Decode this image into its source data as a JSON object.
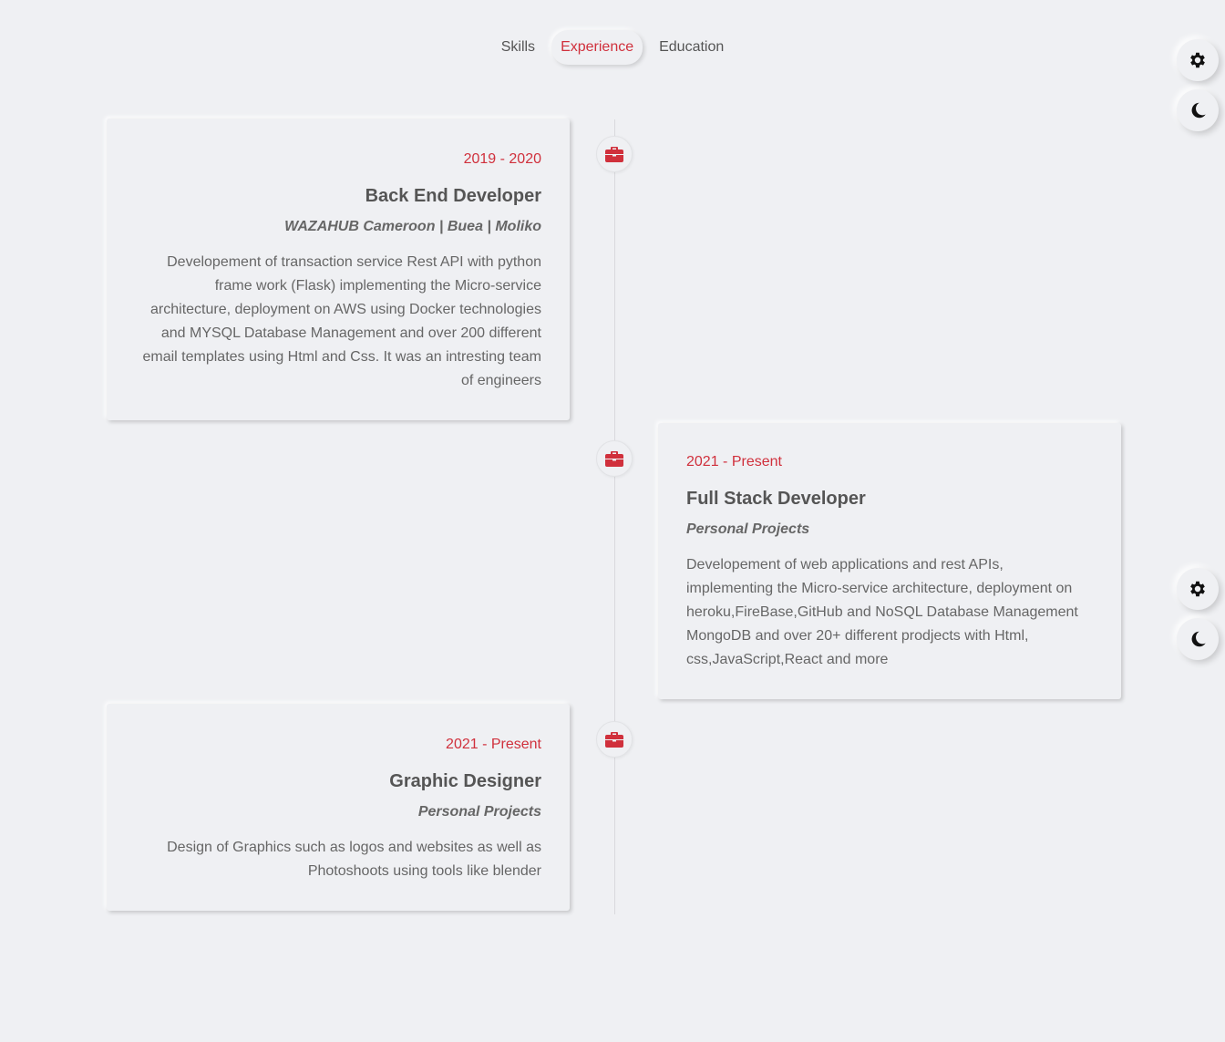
{
  "tabs": [
    {
      "label": "Skills"
    },
    {
      "label": "Experience"
    },
    {
      "label": "Education"
    }
  ],
  "active_tab": "Experience",
  "accent_color": "#d0303c",
  "icons": {
    "settings": "gear-icon",
    "theme": "moon-icon",
    "timeline_node": "briefcase-icon"
  },
  "experience": [
    {
      "period": "2019 - 2020",
      "role": "Back End Developer",
      "company": "WAZAHUB Cameroon | Buea | Moliko",
      "description": "Developement of transaction service Rest API with python frame work (Flask) implementing the Micro-service architecture, deployment on AWS using Docker technologies and MYSQL Database Management and over 200 different email templates using Html and Css. It was an intresting team of engineers"
    },
    {
      "period": "2021 - Present",
      "role": "Full Stack Developer",
      "company": "Personal Projects",
      "description": "Developement of web applications and rest APIs, implementing the Micro-service architecture, deployment on heroku,FireBase,GitHub and NoSQL Database Management MongoDB and over 20+ different prodjects with Html, css,JavaScript,React and more"
    },
    {
      "period": "2021 - Present",
      "role": "Graphic Designer",
      "company": "Personal Projects",
      "description": "Design of Graphics such as logos and websites as well as Photoshoots using tools like blender"
    }
  ]
}
